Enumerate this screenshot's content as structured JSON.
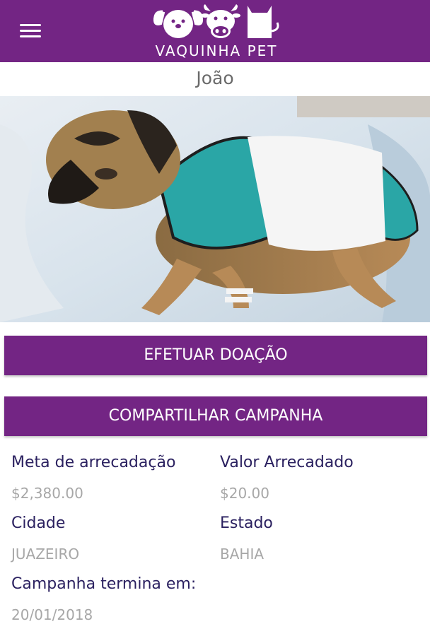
{
  "header": {
    "menu_icon": "hamburger-menu-icon",
    "logo_text": "VAQUINHA PET",
    "background": "#732584"
  },
  "campaign": {
    "pet_name": "João",
    "photo_description_icon": "dog-photo"
  },
  "actions": {
    "donate_label": "EFETUAR DOAÇÃO",
    "share_label": "COMPARTILHAR CAMPANHA"
  },
  "details": {
    "goal_label": "Meta de arrecadação",
    "goal_value": "$2,380.00",
    "raised_label": "Valor Arrecadado",
    "raised_value": "$20.00",
    "city_label": "Cidade",
    "city_value": "JUAZEIRO",
    "state_label": "Estado",
    "state_value": "BAHIA",
    "end_label": "Campanha termina em:",
    "end_value": "20/01/2018"
  }
}
